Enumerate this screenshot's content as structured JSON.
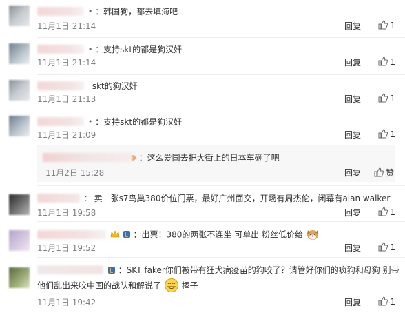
{
  "comments": [
    {
      "level": "•",
      "text": "：韩国狗，都去填海吧",
      "time": "11月1日 21:14",
      "reply": "回复",
      "likes": "1"
    },
    {
      "level": "•",
      "text": "：支持skt的都是狗汉奸",
      "time": "11月1日 21:14",
      "reply": "回复",
      "likes": "1"
    },
    {
      "level": "",
      "text": "skt的狗汉奸",
      "time": "11月1日 21:13",
      "reply": "回复",
      "likes": "1"
    },
    {
      "level": "•",
      "text": "：支持skt的都是狗汉奸",
      "time": "11月1日 21:09",
      "reply": "回复",
      "likes": "1"
    },
    {
      "nested": true,
      "text": "：这么爱国去把大街上的日本车砸了吧",
      "time": "11月2日 15:28",
      "reply": "回复",
      "likes": "赞"
    },
    {
      "level": "：",
      "text": "卖一张s7鸟巢380价位门票，最好广州面交，开场有周杰伦，闭幕有alan walker",
      "time": "11月1日 19:58",
      "reply": "回复",
      "likes": "1"
    },
    {
      "level": "",
      "text": "：出票！380的两张不连坐  可单出  粉丝低价给",
      "time": "11月1日 19:52",
      "reply": "回复",
      "likes": "1"
    },
    {
      "level": "",
      "text_line1": "：SKT faker你们被带有狂犬病疫苗的狗咬了？请管好你们的疯狗和母狗 别带",
      "text_line2": "他们乱出来咬中国的战队和解说了",
      "text_tail": "棒子",
      "time": "11月1日 19:42",
      "reply": "回复",
      "likes": "1"
    }
  ],
  "icons": {
    "thumb": "thumb-up-icon",
    "smile": "smile-emoji-icon",
    "dog": "dog-emoji-icon"
  },
  "colors": {
    "meta": "#808080",
    "nested_bg": "#f7f7f7",
    "divider": "#eeeeee"
  }
}
